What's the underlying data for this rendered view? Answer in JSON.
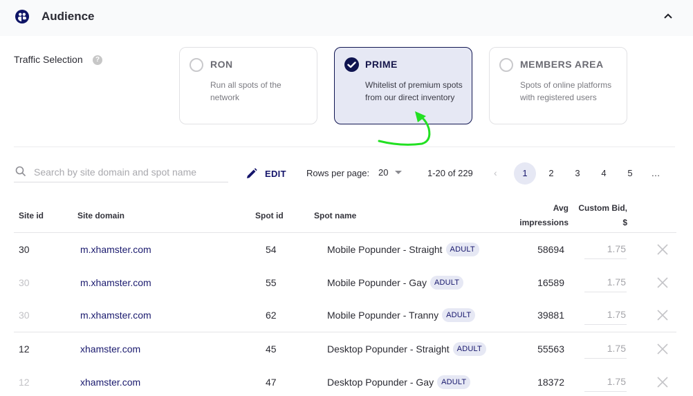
{
  "header": {
    "title": "Audience",
    "icon": "audience-icon",
    "collapse_icon": "chevron-up-icon"
  },
  "traffic_selection": {
    "label": "Traffic Selection",
    "help_icon": "?",
    "options": [
      {
        "title": "RON",
        "description": "Run all spots of the network",
        "selected": false
      },
      {
        "title": "PRIME",
        "description": "Whitelist of premium spots from our direct inventory",
        "selected": true
      },
      {
        "title": "MEMBERS AREA",
        "description": "Spots of online platforms with registered users",
        "selected": false
      }
    ]
  },
  "toolbar": {
    "search_placeholder": "Search by site domain and spot name",
    "search_value": "",
    "edit_label": "EDIT",
    "rows_per_page_label": "Rows per page:",
    "rows_per_page_value": "20",
    "range_text": "1-20 of 229",
    "prev_icon": "‹",
    "pages": [
      "1",
      "2",
      "3",
      "4",
      "5",
      "…"
    ],
    "current_page": "1"
  },
  "table": {
    "headers": {
      "site_id": "Site id",
      "site_domain": "Site domain",
      "spot_id": "Spot id",
      "spot_name": "Spot name",
      "avg_impressions_1": "Avg",
      "avg_impressions_2": "impressions",
      "custom_bid_1": "Custom Bid,",
      "custom_bid_2": "$"
    },
    "rows": [
      {
        "site_id": "30",
        "site_domain": "m.xhamster.com",
        "spot_id": "54",
        "spot_name": "Mobile Popunder - Straight",
        "badge": "ADULT",
        "avg_impressions": "58694",
        "custom_bid": "1.75"
      },
      {
        "site_id": "30",
        "site_domain": "m.xhamster.com",
        "spot_id": "55",
        "spot_name": "Mobile Popunder - Gay",
        "badge": "ADULT",
        "avg_impressions": "16589",
        "custom_bid": "1.75"
      },
      {
        "site_id": "30",
        "site_domain": "m.xhamster.com",
        "spot_id": "62",
        "spot_name": "Mobile Popunder - Tranny",
        "badge": "ADULT",
        "avg_impressions": "39881",
        "custom_bid": "1.75"
      },
      {
        "site_id": "12",
        "site_domain": "xhamster.com",
        "spot_id": "45",
        "spot_name": "Desktop Popunder - Straight",
        "badge": "ADULT",
        "avg_impressions": "55563",
        "custom_bid": "1.75"
      },
      {
        "site_id": "12",
        "site_domain": "xhamster.com",
        "spot_id": "47",
        "spot_name": "Desktop Popunder - Gay",
        "badge": "ADULT",
        "avg_impressions": "18372",
        "custom_bid": "1.75"
      }
    ]
  },
  "colors": {
    "accent": "#15156b",
    "selected_card_bg": "#e6e8f4",
    "annotation_arrow": "#22e022"
  }
}
